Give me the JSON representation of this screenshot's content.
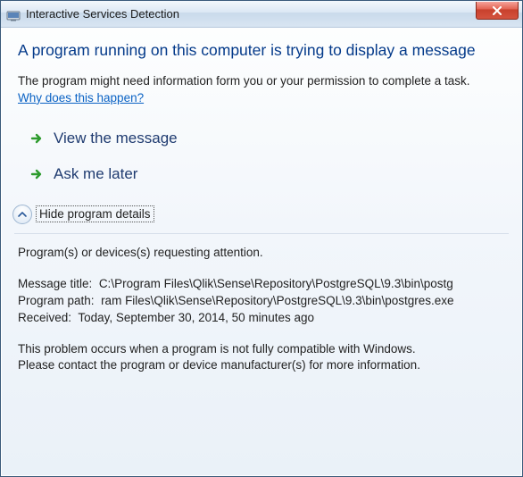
{
  "window": {
    "title": "Interactive Services Detection"
  },
  "heading": "A program running on this computer is trying to display a message",
  "subtext": "The program might need information form you or your permission to complete a task.",
  "link_text": "Why does this happen?",
  "actions": {
    "view": "View the message",
    "later": "Ask me later"
  },
  "expander": {
    "label": "Hide program details"
  },
  "details": {
    "intro": "Program(s) or devices(s) requesting attention.",
    "message_title_label": "Message title:",
    "message_title_value": "C:\\Program Files\\Qlik\\Sense\\Repository\\PostgreSQL\\9.3\\bin\\postg",
    "program_path_label": "Program path:",
    "program_path_value": "ram Files\\Qlik\\Sense\\Repository\\PostgreSQL\\9.3\\bin\\postgres.exe",
    "received_label": "Received:",
    "received_value": "Today, September 30, 2014, 50 minutes ago",
    "footer1": "This problem occurs when a program is not fully compatible with Windows.",
    "footer2": "Please contact the program or device manufacturer(s) for more information."
  }
}
